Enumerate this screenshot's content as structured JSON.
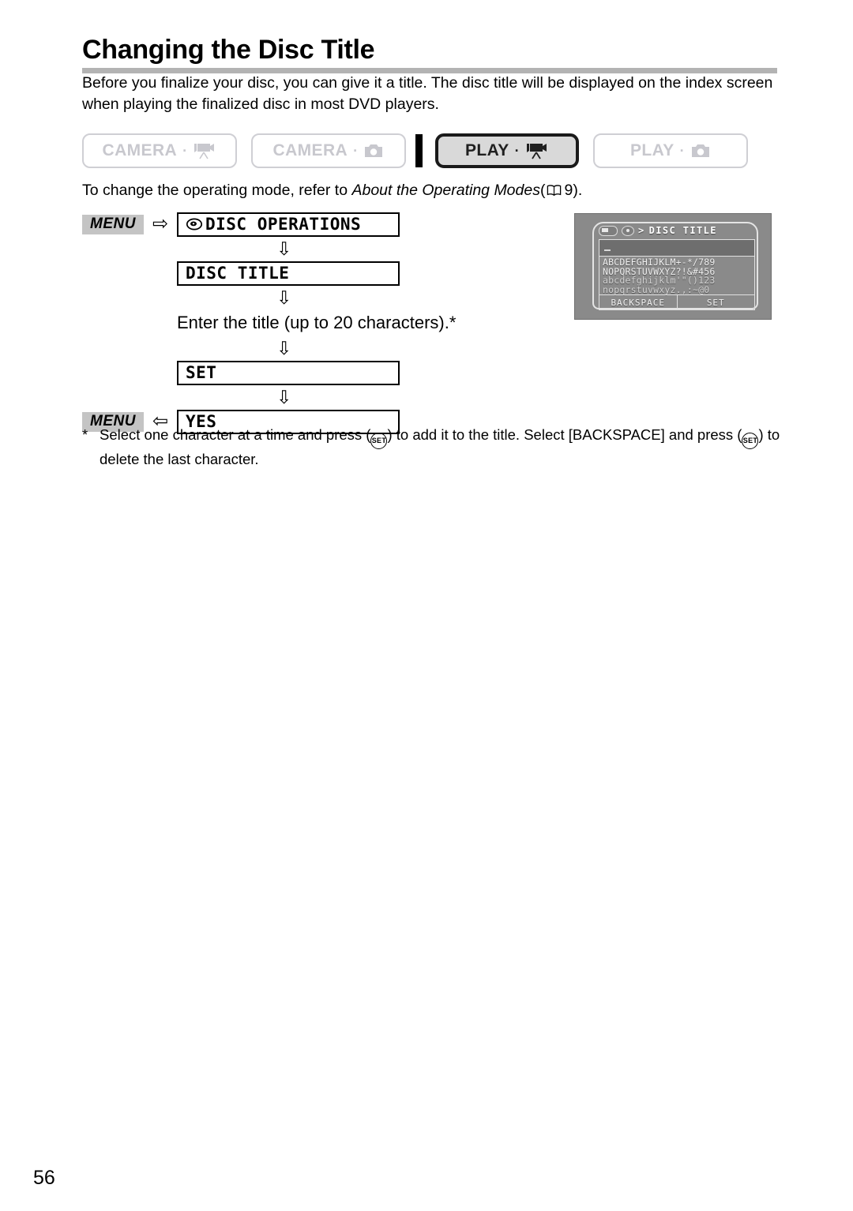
{
  "document": {
    "page_number": "56",
    "title": "Changing the Disc Title",
    "intro": "Before you finalize your disc, you can give it a title. The disc title will be displayed on the index screen when playing the finalized disc in most DVD players."
  },
  "modes": {
    "badges": [
      {
        "label": "CAMERA",
        "icon": "camcorder-icon",
        "state": "inactive"
      },
      {
        "label": "CAMERA",
        "icon": "photo-camera-icon",
        "state": "inactive"
      },
      {
        "label": "PLAY",
        "icon": "camcorder-icon",
        "state": "active"
      },
      {
        "label": "PLAY",
        "icon": "photo-camera-icon",
        "state": "inactive"
      }
    ],
    "separator_dot": "·",
    "note_prefix": "To change the operating mode, refer to ",
    "note_italic": "About the Operating Modes",
    "note_suffix": "9).",
    "note_open_paren": "("
  },
  "flow": {
    "menu_tag": "MENU",
    "arrow_right": "⇨",
    "arrow_left": "⇦",
    "arrow_down": "⇩",
    "step1_label": "DISC OPERATIONS",
    "step2_label": "DISC TITLE",
    "step3_text": "Enter the title (up to 20 characters).*",
    "step4_label": "SET",
    "step5_label": "YES"
  },
  "lcd": {
    "header_title": "DISC TITLE",
    "header_separator": ">",
    "input_value": "",
    "char_rows": [
      "ABCDEFGHIJKLM+-*/789",
      "NOPQRSTUVWXYZ?!&#456",
      "abcdefghijklm'\"()123",
      "nopqrstuvwxyz.,:~@0"
    ],
    "button_backspace": "BACKSPACE",
    "button_set": "SET"
  },
  "footnote": {
    "marker": "*",
    "part1": "Select one character at a time and press (",
    "set_label": "SET",
    "part2": ") to add it to the title. Select [BACKSPACE] and press (",
    "part3": ") to delete the last character."
  }
}
